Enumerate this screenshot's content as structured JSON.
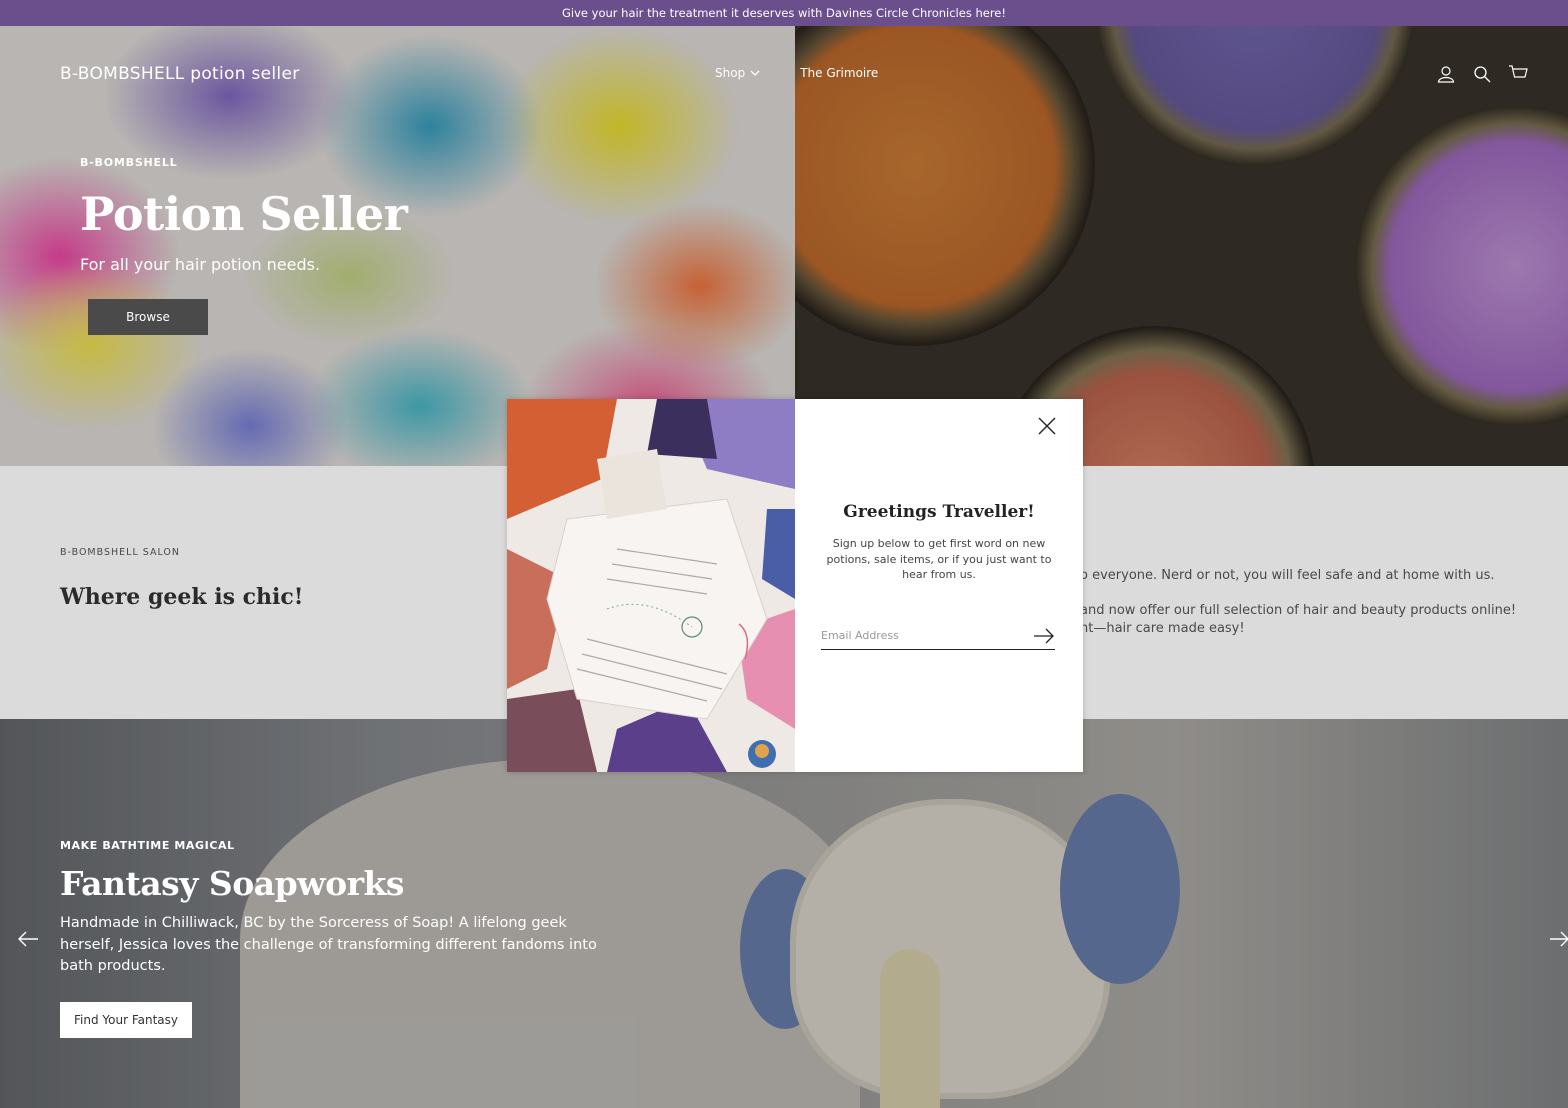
{
  "announcement": {
    "text": "Give your hair the treatment it deserves with Davines Circle Chronicles here!"
  },
  "header": {
    "logo": "B-BOMBSHELL potion seller",
    "nav": [
      {
        "label": "Shop",
        "has_dropdown": true
      },
      {
        "label": "The Grimoire",
        "has_dropdown": false
      }
    ],
    "icons": [
      "account-icon",
      "search-icon",
      "cart-icon"
    ]
  },
  "hero": {
    "eyebrow": "B-BOMBSHELL",
    "title": "Potion Seller",
    "subtitle": "For all your hair potion needs.",
    "button_label": "Browse"
  },
  "intro": {
    "eyebrow": "B-BOMBSHELL SALON",
    "heading": "Where geek is chic!",
    "paragraph_1": "o everyone. Nerd or not, you will feel safe and at home with us.",
    "paragraph_2_line_1": "and now offer our full selection of hair and beauty products online!",
    "paragraph_2_line_2": "nt—hair care made easy!"
  },
  "slideshow": {
    "eyebrow": "MAKE BATHTIME MAGICAL",
    "title": "Fantasy Soapworks",
    "description": "Handmade in Chilliwack, BC by the Sorceress of Soap! A lifelong geek herself, Jessica loves the challenge of transforming different fandoms into bath products.",
    "button_label": "Find Your Fantasy"
  },
  "popup": {
    "title": "Greetings Traveller!",
    "body": "Sign up below to get first word on new potions, sale items, or if you just want to hear from us.",
    "email_placeholder": "Email Address",
    "email_value": ""
  },
  "colors": {
    "announcement_bg": "#6a4f8c",
    "hero_button_bg": "#4a4a4a"
  }
}
